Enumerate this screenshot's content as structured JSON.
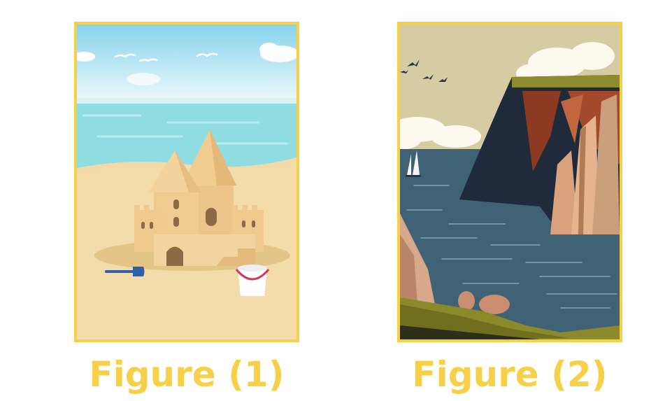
{
  "figures": [
    {
      "caption": "Figure (1)",
      "scene": "sandcastle on beach"
    },
    {
      "caption": "Figure (2)",
      "scene": "sea cliff and sailboats"
    }
  ],
  "colors": {
    "frame": "#f6d147",
    "caption": "#f6d147"
  }
}
